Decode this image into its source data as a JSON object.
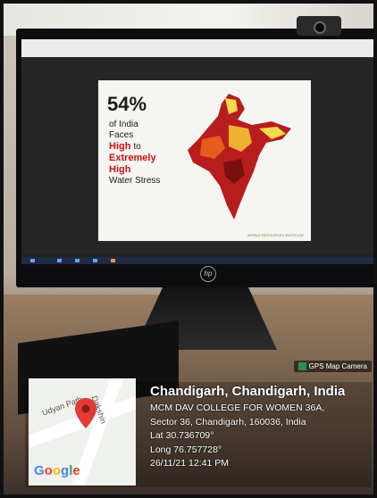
{
  "slide": {
    "percent": "54%",
    "line1": "of India",
    "line2": "Faces",
    "line3": "High",
    "line3b": "to",
    "line4": "Extremely",
    "line5": "High",
    "line6": "Water Stress",
    "footer_right": "WORLD RESOURCES INSTITUTE"
  },
  "gps_tag": {
    "label": "GPS Map Camera",
    "icon": "photo-icon"
  },
  "minimap": {
    "road1": "Udyan Path",
    "road2": "Dakshin Marg",
    "google": "Google",
    "pin_icon": "map-pin-icon"
  },
  "location": {
    "city": "Chandigarh, Chandigarh, India",
    "address1": "MCM DAV COLLEGE FOR WOMEN 36A,",
    "address2": "Sector 36, Chandigarh, 160036, India",
    "lat": "Lat 30.736709°",
    "long": "Long 76.757728°",
    "datetime": "26/11/21 12:41 PM"
  },
  "colors": {
    "pin": "#e53935",
    "brand_blue": "#4285F4",
    "brand_red": "#EA4335",
    "brand_yellow": "#FBBC05",
    "brand_green": "#34A853",
    "slide_red": "#d01010"
  }
}
